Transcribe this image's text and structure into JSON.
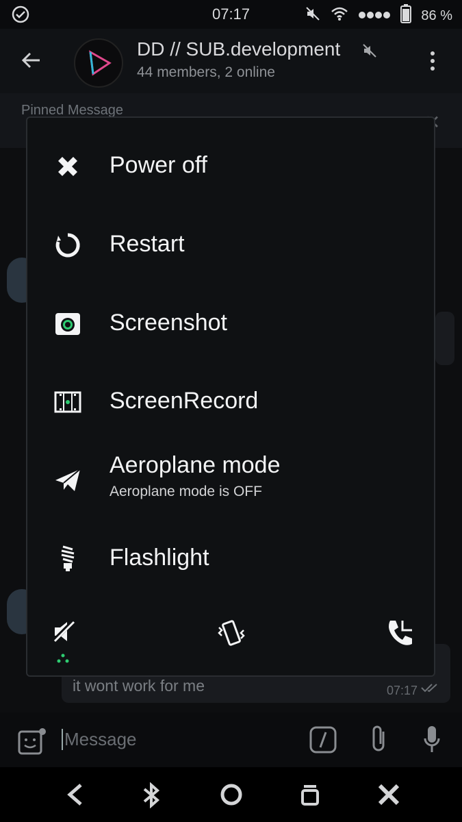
{
  "status_bar": {
    "time": "07:17",
    "battery": "86 %",
    "icons": [
      "check-circle-icon",
      "mute-icon",
      "wifi-icon",
      "signal-dots-icon",
      "battery-icon"
    ]
  },
  "app_bar": {
    "title": "DD // SUB.development",
    "subtitle": "44 members, 2 online"
  },
  "pinned": {
    "label": "Pinned Message"
  },
  "chat": {
    "last_message": {
      "text": "it wont work for me",
      "time": "07:17"
    }
  },
  "input": {
    "placeholder": "Message"
  },
  "power_menu": {
    "items": [
      {
        "label": "Power off",
        "icon": "power-off-icon"
      },
      {
        "label": "Restart",
        "icon": "restart-icon"
      },
      {
        "label": "Screenshot",
        "icon": "screenshot-icon"
      },
      {
        "label": "ScreenRecord",
        "icon": "screenrecord-icon"
      },
      {
        "label": "Aeroplane mode",
        "sublabel": "Aeroplane mode is OFF",
        "icon": "aeroplane-icon"
      },
      {
        "label": "Flashlight",
        "icon": "flashlight-icon"
      }
    ],
    "bottom_toggles": [
      "sound-off-icon",
      "vibrate-icon",
      "ring-icon"
    ],
    "accent": "#2ecc71"
  },
  "colors": {
    "background": "#0b0c0e",
    "dialog_bg": "#0f1113",
    "text_primary": "#f3f4f5",
    "text_secondary": "#8e9196"
  }
}
